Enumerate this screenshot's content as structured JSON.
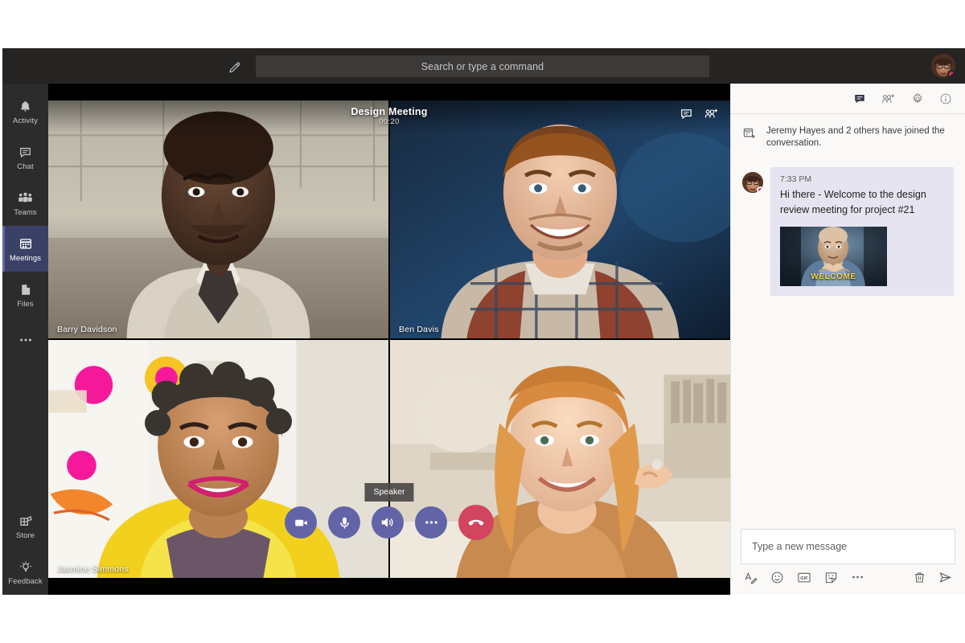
{
  "app": {
    "name": "Microsoft Teams",
    "accent_color": "#6264a7",
    "rail_background": "#2d2c2c",
    "titlebar_background": "#252423",
    "chat_panel_background": "#faf9f8",
    "hangup_color": "#d3455e",
    "bubble_color": "#e5e4f0"
  },
  "titlebar": {
    "compose_icon": "compose-icon",
    "search_placeholder": "Search or type a command",
    "avatar_icon": "user-avatar",
    "presence": "busy"
  },
  "rail": {
    "items": [
      {
        "label": "Activity",
        "icon": "bell-icon",
        "selected": false
      },
      {
        "label": "Chat",
        "icon": "chat-bubble-icon",
        "selected": false
      },
      {
        "label": "Teams",
        "icon": "people-icon",
        "selected": false
      },
      {
        "label": "Meetings",
        "icon": "calendar-icon",
        "selected": true
      },
      {
        "label": "Files",
        "icon": "file-icon",
        "selected": false
      },
      {
        "label": "",
        "icon": "ellipsis-icon",
        "selected": false
      }
    ],
    "bottom_items": [
      {
        "label": "Store",
        "icon": "store-icon"
      },
      {
        "label": "Feedback",
        "icon": "lightbulb-icon"
      }
    ]
  },
  "meeting": {
    "title": "Design Meeting",
    "timer": "00:20",
    "header_actions": [
      {
        "name": "show-conversation",
        "icon": "chat-bubble-icon"
      },
      {
        "name": "add-participants",
        "icon": "person-add-icon"
      }
    ],
    "participants": [
      {
        "name": "Barry Davidson",
        "position": "top-left"
      },
      {
        "name": "Ben Davis",
        "position": "top-right"
      },
      {
        "name": "Jasmine Simmons",
        "position": "bottom-left"
      },
      {
        "name": "",
        "position": "bottom-right"
      }
    ],
    "tooltip": "Speaker",
    "controls": [
      {
        "name": "toggle-camera",
        "icon": "video-camera-icon",
        "style": "primary"
      },
      {
        "name": "toggle-microphone",
        "icon": "microphone-icon",
        "style": "primary"
      },
      {
        "name": "toggle-speaker",
        "icon": "speaker-icon",
        "style": "primary"
      },
      {
        "name": "more-options",
        "icon": "ellipsis-icon",
        "style": "primary"
      },
      {
        "name": "hang-up",
        "icon": "phone-hangup-icon",
        "style": "danger"
      }
    ]
  },
  "chat": {
    "header_actions": [
      {
        "name": "conversation-tab",
        "icon": "chat-bubble-icon",
        "active": true
      },
      {
        "name": "add-people",
        "icon": "person-add-icon",
        "active": false
      },
      {
        "name": "settings",
        "icon": "gear-icon",
        "active": false
      },
      {
        "name": "info",
        "icon": "info-icon",
        "active": false
      }
    ],
    "system_message": {
      "icon": "calendar-add-icon",
      "text": "Jeremy Hayes and 2 others have joined the conversation."
    },
    "messages": [
      {
        "time": "7:33 PM",
        "text": "Hi there - Welcome to the design review meeting for project #21",
        "avatar": "user-avatar",
        "presence": "busy",
        "media_caption": "WELCOME"
      }
    ],
    "composer": {
      "placeholder": "Type a new message",
      "left_tools": [
        {
          "name": "format-text",
          "icon": "format-text-icon"
        },
        {
          "name": "emoji",
          "icon": "emoji-icon"
        },
        {
          "name": "giphy",
          "icon": "gif-icon"
        },
        {
          "name": "sticker",
          "icon": "sticker-icon"
        },
        {
          "name": "more-actions",
          "icon": "ellipsis-icon"
        }
      ],
      "right_tools": [
        {
          "name": "delete-draft",
          "icon": "trash-icon"
        },
        {
          "name": "send-message",
          "icon": "send-icon"
        }
      ]
    }
  }
}
